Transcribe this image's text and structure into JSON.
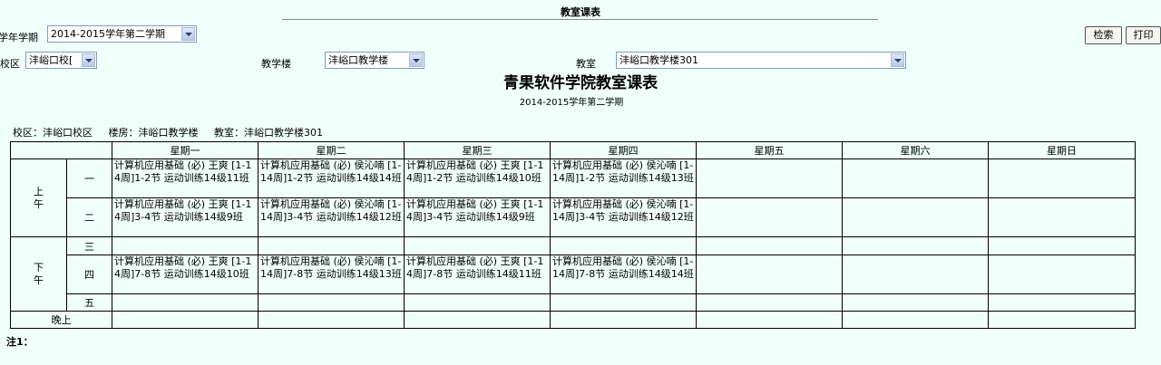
{
  "header": {
    "title": "教室课表"
  },
  "filters": {
    "term_label": "学年学期",
    "term_value": "2014-2015学年第二学期",
    "campus_label": "校区",
    "campus_value": "沣峪口校[",
    "building_label": "教学楼",
    "building_value": "沣峪口教学楼",
    "room_label": "教室",
    "room_value": "沣峪口教学楼301"
  },
  "toolbar": {
    "search_label": "检索",
    "print_label": "打印"
  },
  "report": {
    "school_title": "青果软件学院教室课表",
    "term": "2014-2015学年第二学期",
    "info_campus": "校区：沣峪口校区",
    "info_building": "楼房：沣峪口教学楼",
    "info_room": "教室：沣峪口教学楼301"
  },
  "timetable": {
    "days": [
      "星期一",
      "星期二",
      "星期三",
      "星期四",
      "星期五",
      "星期六",
      "星期日"
    ],
    "periods": {
      "morning": "上午",
      "afternoon": "下午",
      "evening": "晚上",
      "p1": "一",
      "p2": "二",
      "p3": "三",
      "p4": "四",
      "p5": "五"
    },
    "rows": {
      "p1": [
        "计算机应用基础 (必) 王爽 [1-14周]1-2节 运动训练14级11班",
        "计算机应用基础 (必) 侯沁喃 [1-14周]1-2节 运动训练14级14班",
        "计算机应用基础 (必) 王爽 [1-14周]1-2节 运动训练14级10班",
        "计算机应用基础 (必) 侯沁喃 [1-14周]1-2节 运动训练14级13班",
        "",
        "",
        ""
      ],
      "p2": [
        "计算机应用基础 (必) 王爽 [1-14周]3-4节 运动训练14级9班",
        "计算机应用基础 (必) 侯沁喃 [1-14周]3-4节 运动训练14级12班",
        "计算机应用基础 (必) 王爽 [1-14周]3-4节 运动训练14级9班",
        "计算机应用基础 (必) 侯沁喃 [1-14周]3-4节 运动训练14级12班",
        "",
        "",
        ""
      ],
      "p4": [
        "计算机应用基础 (必) 王爽 [1-14周]7-8节 运动训练14级10班",
        "计算机应用基础 (必) 侯沁喃 [1-14周]7-8节 运动训练14级13班",
        "计算机应用基础 (必) 王爽 [1-14周]7-8节 运动训练14级11班",
        "计算机应用基础 (必) 侯沁喃 [1-14周]7-8节 运动训练14级14班",
        "",
        "",
        ""
      ]
    }
  },
  "footer": {
    "note": "注1："
  }
}
